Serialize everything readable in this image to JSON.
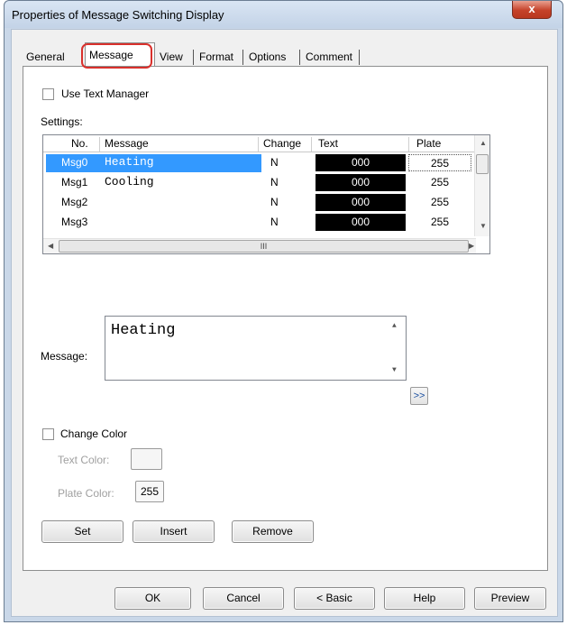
{
  "window": {
    "title": "Properties of Message Switching Display",
    "close_glyph": "x"
  },
  "tabs": [
    {
      "label": "General"
    },
    {
      "label": "Message"
    },
    {
      "label": "View"
    },
    {
      "label": "Format"
    },
    {
      "label": "Options"
    },
    {
      "label": "Comment"
    }
  ],
  "message_tab": {
    "use_text_manager_label": "Use Text Manager",
    "settings_label": "Settings:",
    "columns": [
      "No.",
      "Message",
      "Change",
      "Text",
      "Plate"
    ],
    "rows": [
      {
        "no": "Msg0",
        "message": "Heating",
        "change": "N",
        "text": "000",
        "plate": "255"
      },
      {
        "no": "Msg1",
        "message": "Cooling",
        "change": "N",
        "text": "000",
        "plate": "255"
      },
      {
        "no": "Msg2",
        "message": "",
        "change": "N",
        "text": "000",
        "plate": "255"
      },
      {
        "no": "Msg3",
        "message": "",
        "change": "N",
        "text": "000",
        "plate": "255"
      }
    ],
    "hscroll_grip": "III",
    "message_label": "Message:",
    "message_value": "Heating",
    "expand_button": ">>",
    "change_color_label": "Change Color",
    "text_color_label": "Text Color:",
    "plate_color_label": "Plate Color:",
    "plate_color_value": "255",
    "set_button": "Set",
    "insert_button": "Insert",
    "remove_button": "Remove"
  },
  "footer": {
    "ok": "OK",
    "cancel": "Cancel",
    "basic": "< Basic",
    "help": "Help",
    "preview": "Preview"
  },
  "colors": {
    "selection": "#3399ff",
    "highlight_ring": "#d9302c",
    "swatch_black": "#000000"
  }
}
